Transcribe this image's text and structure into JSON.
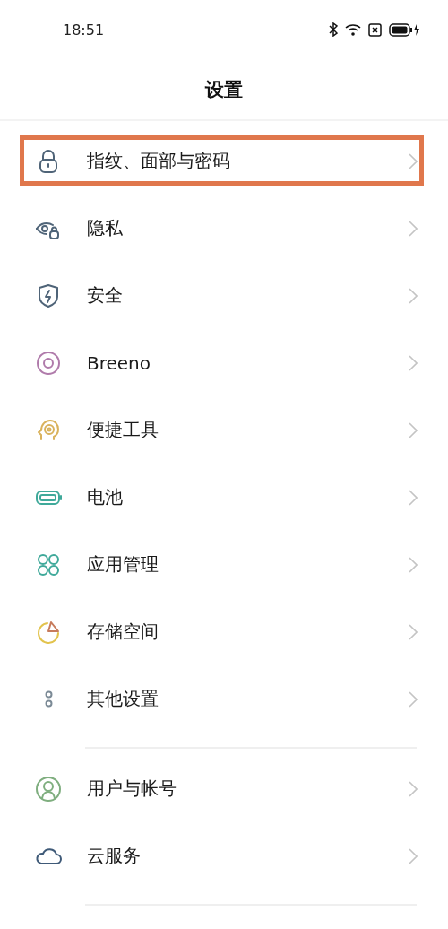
{
  "status_bar": {
    "time": "18:51"
  },
  "title": "设置",
  "sections": [
    {
      "items": [
        {
          "label": "指纹、面部与密码",
          "highlighted": true
        },
        {
          "label": "隐私",
          "highlighted": false
        },
        {
          "label": "安全",
          "highlighted": false
        },
        {
          "label": "Breeno",
          "highlighted": false
        },
        {
          "label": "便捷工具",
          "highlighted": false
        },
        {
          "label": "电池",
          "highlighted": false
        },
        {
          "label": "应用管理",
          "highlighted": false
        },
        {
          "label": "存储空间",
          "highlighted": false
        },
        {
          "label": "其他设置",
          "highlighted": false
        }
      ]
    },
    {
      "items": [
        {
          "label": "用户与帐号",
          "highlighted": false
        },
        {
          "label": "云服务",
          "highlighted": false
        }
      ]
    }
  ]
}
